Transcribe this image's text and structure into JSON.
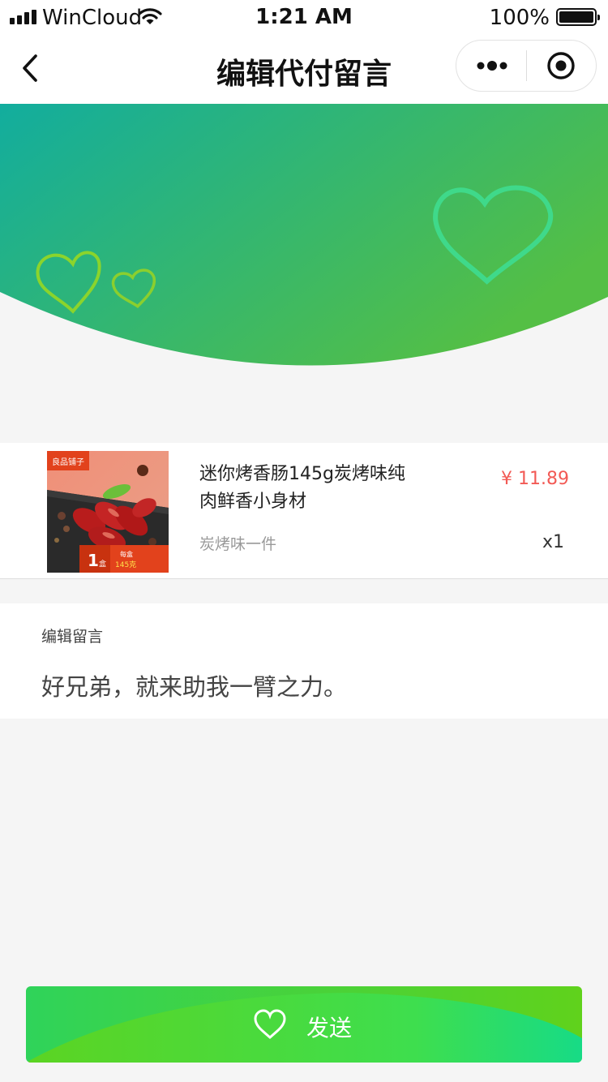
{
  "status_bar": {
    "carrier": "WinCloud",
    "time": "1:21 AM",
    "battery": "100%"
  },
  "nav": {
    "title": "编辑代付留言",
    "back_icon": "chevron-left-icon",
    "more_icon": "more-dots-icon",
    "close_icon": "target-circle-icon"
  },
  "hero": {
    "gradient_start": "#12ad9e",
    "gradient_end": "#54bf45"
  },
  "product": {
    "name": "迷你烤香肠145g炭烤味纯肉鲜香小身材",
    "variant": "炭烤味一件",
    "price": "¥ 11.89",
    "quantity": "x1",
    "image": {
      "brand_tag": "良品铺子",
      "count": "1",
      "count_unit": "盒",
      "box_label": "每盒",
      "weight": "145克"
    },
    "price_color": "#f25a55"
  },
  "message": {
    "label": "编辑留言",
    "text": "好兄弟，就来助我一臂之力。"
  },
  "send_button": {
    "label": "发送",
    "icon": "heart-outline-icon",
    "color_a": "#3dd65c",
    "color_b": "#5cd422"
  }
}
